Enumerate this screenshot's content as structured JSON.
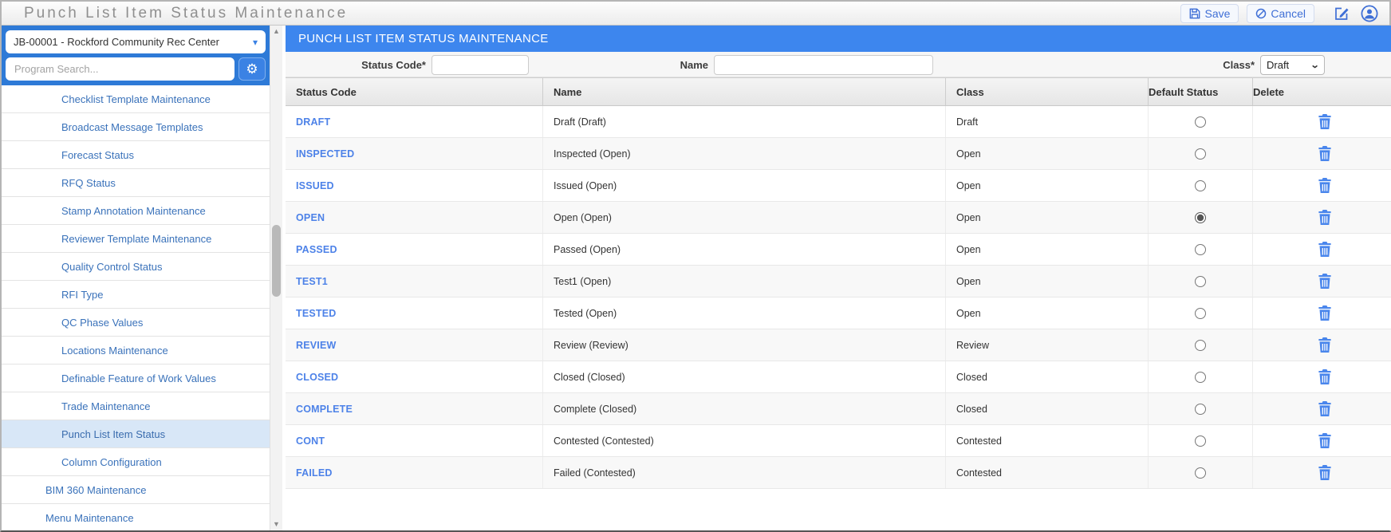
{
  "colors": {
    "accent_blue": "#3b82e4",
    "panel_header_blue": "#3d86ee",
    "sidebar_header_blue": "#2e7ad7",
    "table_link_blue": "#4d82e8",
    "sidebar_link_blue": "#3a72ba",
    "selected_item_bg": "#d8e7f7",
    "title_gray": "#8f8f8f",
    "trash_blue": "#4a86ec"
  },
  "titlebar": {
    "title": "Punch List Item Status Maintenance",
    "save_label": "Save",
    "cancel_label": "Cancel"
  },
  "sidebar": {
    "project_select": {
      "value": "JB-00001 - Rockford Community Rec Center"
    },
    "search": {
      "placeholder": "Program Search..."
    },
    "items": [
      {
        "label": "Checklist Template Maintenance",
        "level": 2,
        "selected": false
      },
      {
        "label": "Broadcast Message Templates",
        "level": 2,
        "selected": false
      },
      {
        "label": "Forecast Status",
        "level": 2,
        "selected": false
      },
      {
        "label": "RFQ Status",
        "level": 2,
        "selected": false
      },
      {
        "label": "Stamp Annotation Maintenance",
        "level": 2,
        "selected": false
      },
      {
        "label": "Reviewer Template Maintenance",
        "level": 2,
        "selected": false
      },
      {
        "label": "Quality Control Status",
        "level": 2,
        "selected": false
      },
      {
        "label": "RFI Type",
        "level": 2,
        "selected": false
      },
      {
        "label": "QC Phase Values",
        "level": 2,
        "selected": false
      },
      {
        "label": "Locations Maintenance",
        "level": 2,
        "selected": false
      },
      {
        "label": "Definable Feature of Work Values",
        "level": 2,
        "selected": false
      },
      {
        "label": "Trade Maintenance",
        "level": 2,
        "selected": false
      },
      {
        "label": "Punch List Item Status",
        "level": 2,
        "selected": true
      },
      {
        "label": "Column Configuration",
        "level": 2,
        "selected": false
      },
      {
        "label": "BIM 360 Maintenance",
        "level": 1,
        "selected": false
      },
      {
        "label": "Menu Maintenance",
        "level": 1,
        "selected": false
      }
    ]
  },
  "main": {
    "panel_title": "PUNCH LIST ITEM STATUS MAINTENANCE",
    "form": {
      "status_code": {
        "label": "Status Code*",
        "value": ""
      },
      "name": {
        "label": "Name",
        "value": ""
      },
      "class": {
        "label": "Class*",
        "value": "Draft"
      }
    },
    "table": {
      "columns": [
        "Status Code",
        "Name",
        "Class",
        "Default Status",
        "Delete"
      ],
      "rows": [
        {
          "status_code": "DRAFT",
          "name": "Draft (Draft)",
          "class": "Draft",
          "default_status": false
        },
        {
          "status_code": "INSPECTED",
          "name": "Inspected (Open)",
          "class": "Open",
          "default_status": false
        },
        {
          "status_code": "ISSUED",
          "name": "Issued (Open)",
          "class": "Open",
          "default_status": false
        },
        {
          "status_code": "OPEN",
          "name": "Open (Open)",
          "class": "Open",
          "default_status": true
        },
        {
          "status_code": "PASSED",
          "name": "Passed (Open)",
          "class": "Open",
          "default_status": false
        },
        {
          "status_code": "TEST1",
          "name": "Test1 (Open)",
          "class": "Open",
          "default_status": false
        },
        {
          "status_code": "TESTED",
          "name": "Tested (Open)",
          "class": "Open",
          "default_status": false
        },
        {
          "status_code": "REVIEW",
          "name": "Review (Review)",
          "class": "Review",
          "default_status": false
        },
        {
          "status_code": "CLOSED",
          "name": "Closed (Closed)",
          "class": "Closed",
          "default_status": false
        },
        {
          "status_code": "COMPLETE",
          "name": "Complete (Closed)",
          "class": "Closed",
          "default_status": false
        },
        {
          "status_code": "CONT",
          "name": "Contested (Contested)",
          "class": "Contested",
          "default_status": false
        },
        {
          "status_code": "FAILED",
          "name": "Failed (Contested)",
          "class": "Contested",
          "default_status": false
        }
      ]
    }
  }
}
